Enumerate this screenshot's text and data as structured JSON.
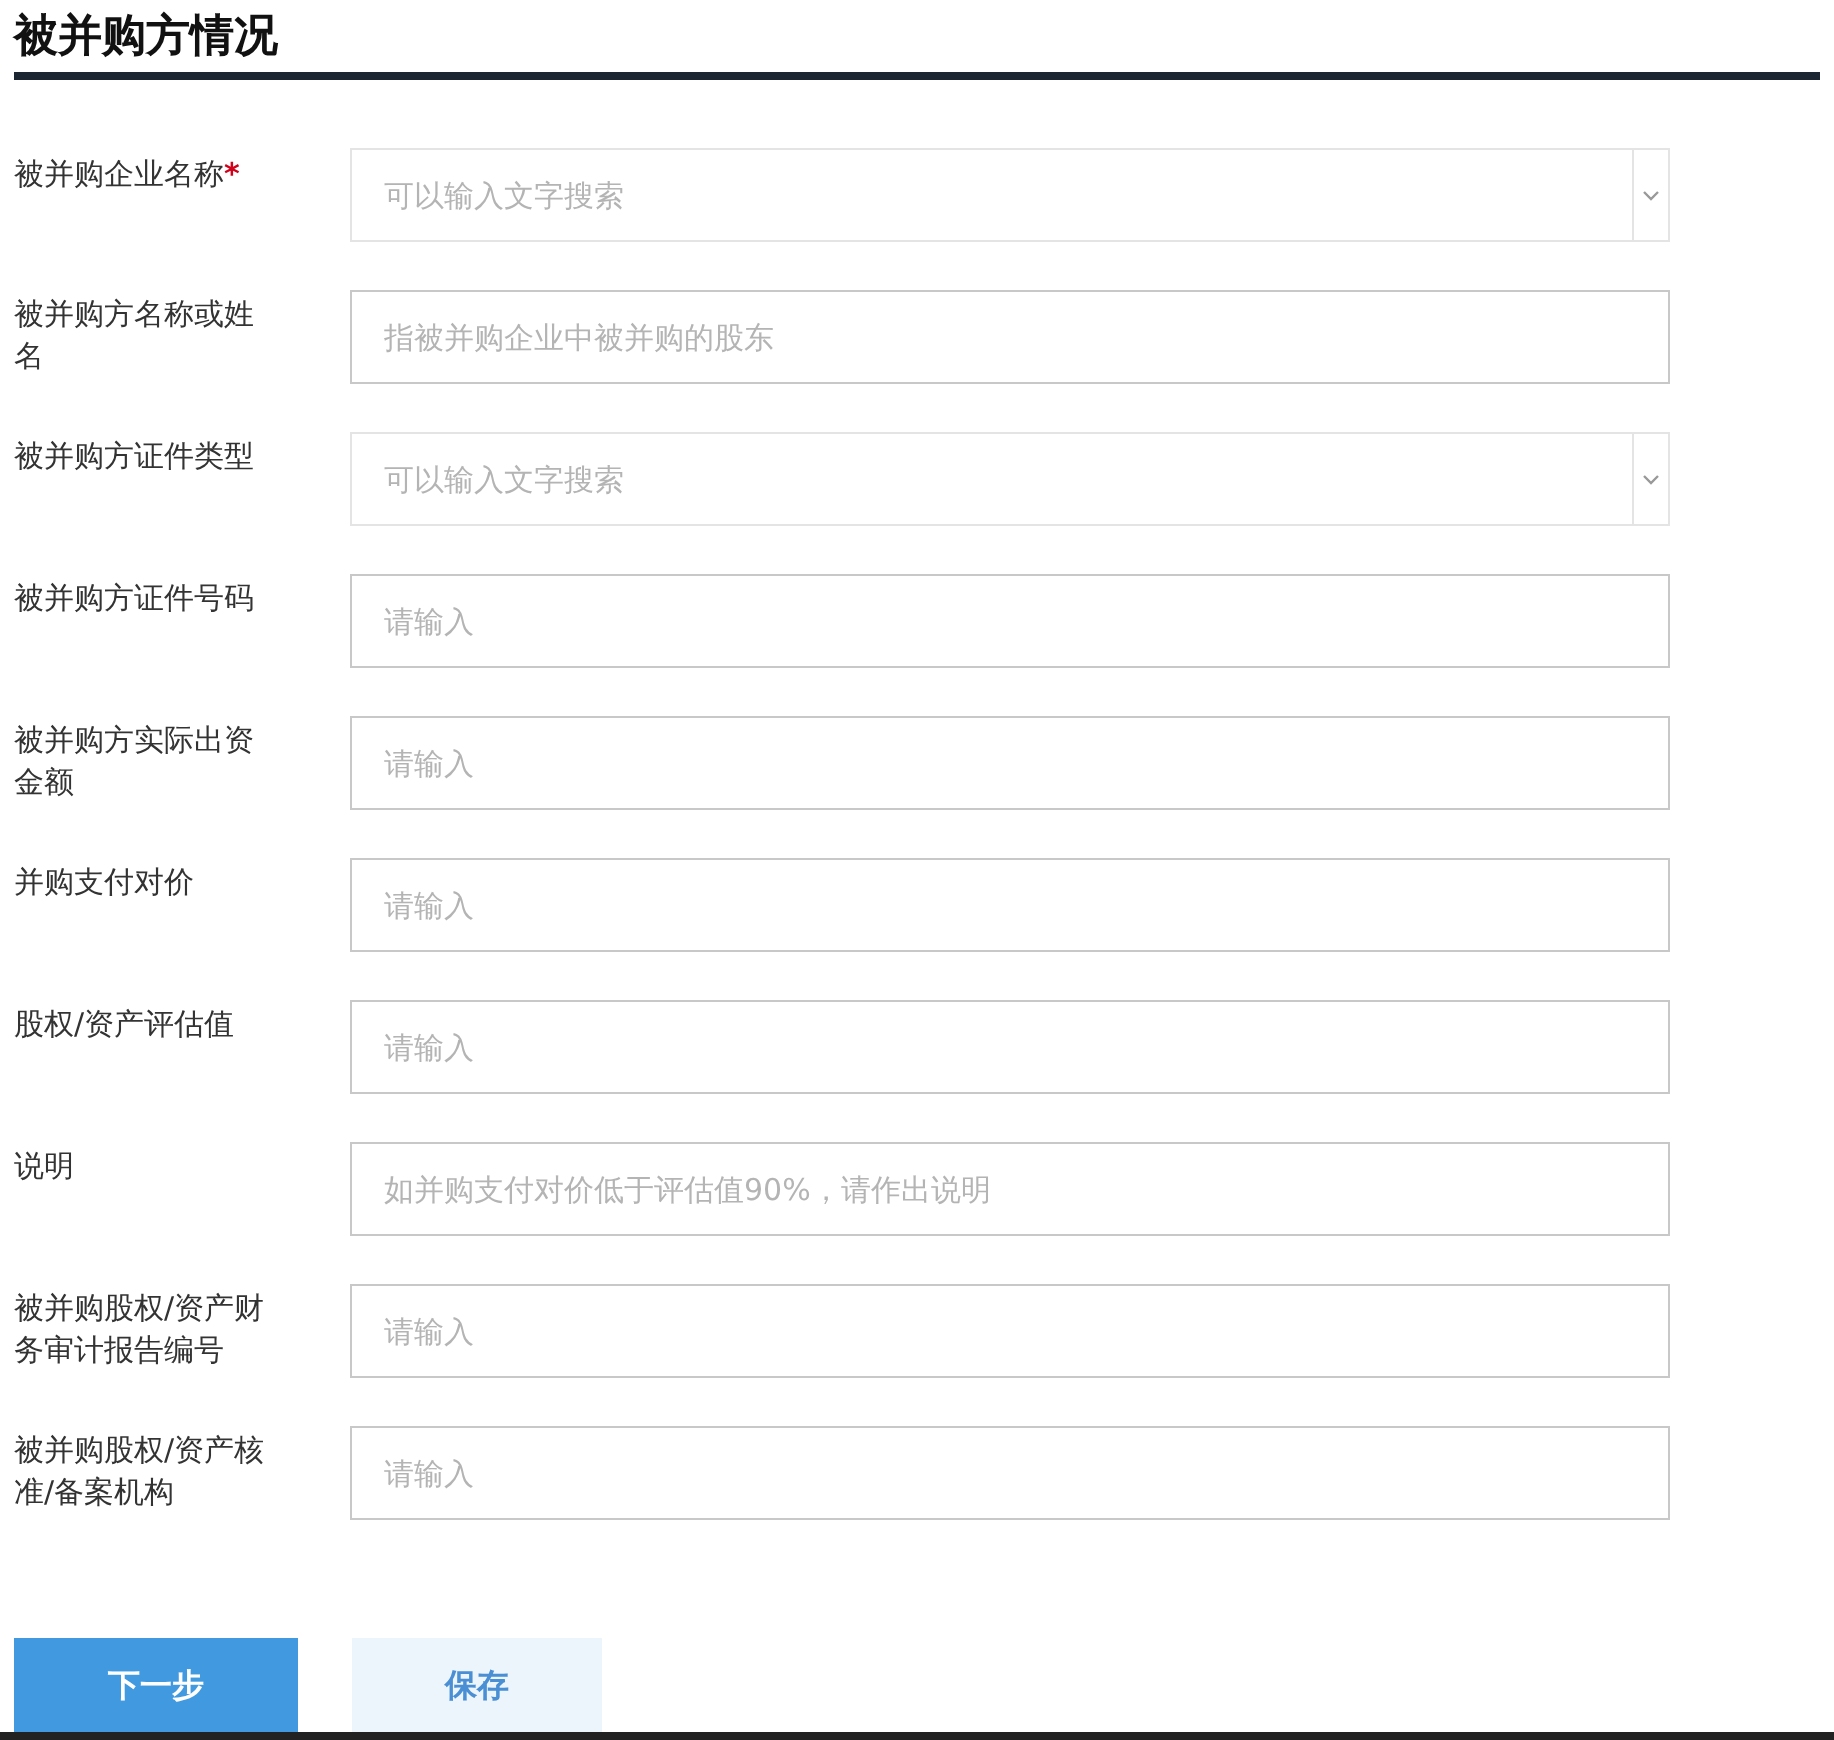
{
  "title": "被并购方情况",
  "fields": [
    {
      "label": "被并购企业名称",
      "required_mark": "*",
      "kind": "select",
      "placeholder": "可以输入文字搜索"
    },
    {
      "label": "被并购方名称或姓名",
      "kind": "text",
      "placeholder": "指被并购企业中被并购的股东"
    },
    {
      "label": "被并购方证件类型",
      "kind": "select",
      "placeholder": "可以输入文字搜索"
    },
    {
      "label": "被并购方证件号码",
      "kind": "text",
      "placeholder": "请输入"
    },
    {
      "label": "被并购方实际出资金额",
      "kind": "text",
      "placeholder": "请输入"
    },
    {
      "label": "并购支付对价",
      "kind": "text",
      "placeholder": "请输入"
    },
    {
      "label": "股权/资产评估值",
      "kind": "text",
      "placeholder": "请输入"
    },
    {
      "label": "说明",
      "kind": "text",
      "placeholder": "如并购支付对价低于评估值90%，请作出说明"
    },
    {
      "label": "被并购股权/资产财务审计报告编号",
      "kind": "text",
      "placeholder": "请输入"
    },
    {
      "label": "被并购股权/资产核准/备案机构",
      "kind": "text",
      "placeholder": "请输入"
    }
  ],
  "buttons": [
    {
      "label": "下一步",
      "kind": "primary"
    },
    {
      "label": "保存",
      "kind": "secondary"
    }
  ]
}
